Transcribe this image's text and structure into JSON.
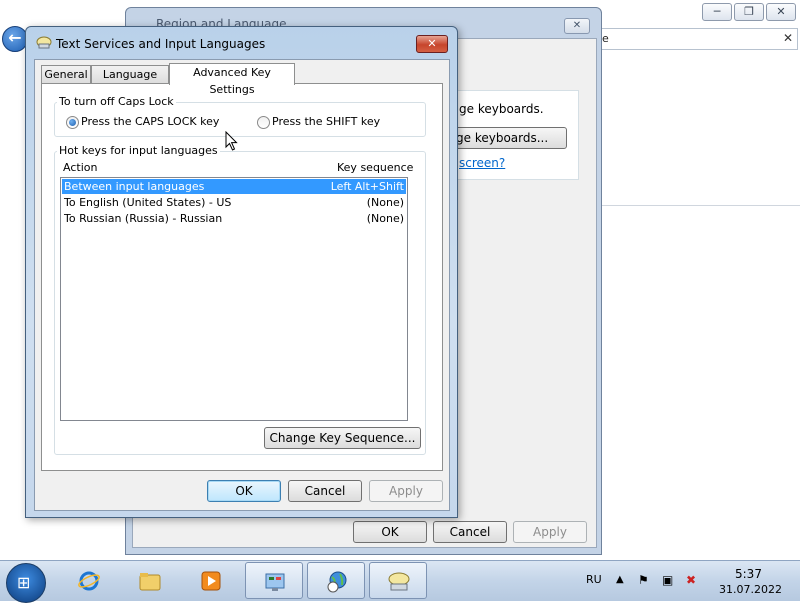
{
  "explorer": {
    "address_text": "ge",
    "address_close": "✕",
    "back_icon": "back-arrow-icon",
    "controls": [
      "─",
      "❐",
      "✕"
    ]
  },
  "region_window": {
    "title": "Region and Language",
    "close": "✕",
    "partial_text": "ge keyboards.",
    "change_keyboards_label": "ge keyboards...",
    "link_text": "screen?",
    "buttons": {
      "ok": "OK",
      "cancel": "Cancel",
      "apply": "Apply"
    }
  },
  "dialog": {
    "title": "Text Services and Input Languages",
    "close": "✕",
    "tabs": [
      {
        "label": "General",
        "active": false
      },
      {
        "label": "Language Bar",
        "active": false
      },
      {
        "label": "Advanced Key Settings",
        "active": true
      }
    ],
    "caps_lock": {
      "group_label": "To turn off Caps Lock",
      "option1": "Press the CAPS LOCK key",
      "option2": "Press the SHIFT key",
      "selected": "option1"
    },
    "hotkeys": {
      "group_label": "Hot keys for input languages",
      "col_action": "Action",
      "col_key": "Key sequence",
      "rows": [
        {
          "action": "Between input languages",
          "key": "Left Alt+Shift",
          "selected": true
        },
        {
          "action": "To English (United States) - US",
          "key": "(None)",
          "selected": false
        },
        {
          "action": "To Russian (Russia) - Russian",
          "key": "(None)",
          "selected": false
        }
      ],
      "change_button": "Change Key Sequence..."
    },
    "buttons": {
      "ok": "OK",
      "cancel": "Cancel",
      "apply": "Apply"
    }
  },
  "taskbar": {
    "items": [
      "windows-explorer-icon-ie",
      "internet-explorer-icon",
      "folder-icon",
      "media-player-icon",
      "control-panel-icon",
      "clock-globe-icon",
      "keyboard-icon"
    ],
    "language": "RU",
    "time": "5:37",
    "date": "31.07.2022"
  },
  "colors": {
    "selection": "#3399ff",
    "link": "#0066cc",
    "close_red": "#c7452c"
  }
}
